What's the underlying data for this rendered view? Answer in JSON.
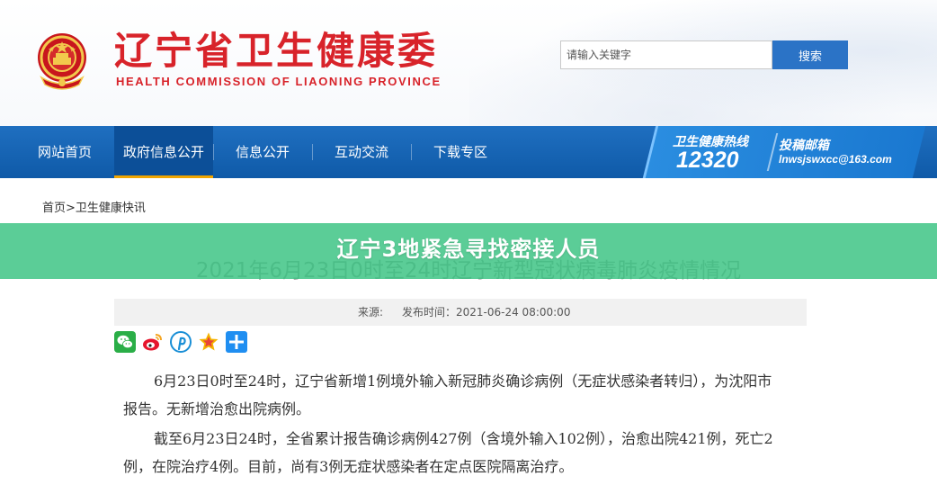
{
  "header": {
    "title": "辽宁省卫生健康委",
    "subtitle": "HEALTH COMMISSION OF LIAONING PROVINCE",
    "search_placeholder": "请输入关键字",
    "search_button": "搜索"
  },
  "nav": {
    "items": [
      {
        "label": "网站首页"
      },
      {
        "label": "政府信息公开"
      },
      {
        "label": "信息公开"
      },
      {
        "label": "互动交流"
      },
      {
        "label": "下载专区"
      }
    ],
    "hotline_label": "卫生健康热线",
    "hotline_number": "12320",
    "mailbox_label": "投稿邮箱",
    "mailbox_email": "lnwsjswxcc@163.com"
  },
  "breadcrumb": {
    "home": "首页",
    "separator": ">",
    "section": "卫生健康快讯"
  },
  "overlay": {
    "title": "辽宁3地紧急寻找密接人员",
    "color": "#4fc98f"
  },
  "article": {
    "title": "2021年6月23日0时至24时辽宁新型冠状病毒肺炎疫情情况",
    "source_label": "来源:",
    "publish_time": "发布时间：2021-06-24 08:00:00",
    "paragraphs": [
      "6月23日0时至24时，辽宁省新增1例境外输入新冠肺炎确诊病例（无症状感染者转归），为沈阳市报告。无新增治愈出院病例。",
      "截至6月23日24时，全省累计报告确诊病例427例（含境外输入102例），治愈出院421例，死亡2例，在院治疗4例。目前，尚有3例无症状感染者在定点医院隔离治疗。"
    ]
  },
  "share_icons": [
    "wechat-icon",
    "weibo-icon",
    "pinterest-icon",
    "favorite-star-icon",
    "more-share-icon"
  ],
  "colors": {
    "brand_red": "#d8232a",
    "nav_blue": "#1f6fc0",
    "search_blue": "#2b73c6"
  }
}
